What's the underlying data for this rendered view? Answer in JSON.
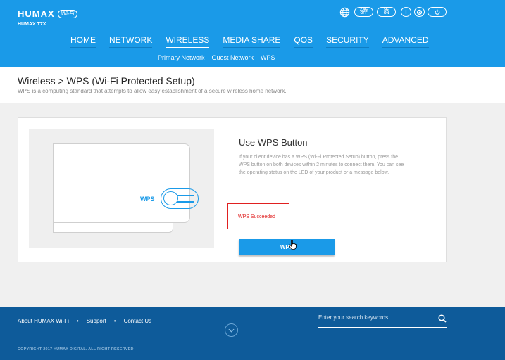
{
  "brand": {
    "name": "HUMAX",
    "badge": "Wi-Fi",
    "model": "HUMAX T7X"
  },
  "top_icons": [
    {
      "name": "globe-icon"
    },
    {
      "name": "band-2g-icon",
      "label": "2.4G\nOFF"
    },
    {
      "name": "band-5g-icon",
      "label": "5G\nON"
    },
    {
      "name": "info-icon",
      "label": "i"
    },
    {
      "name": "settings-icon"
    },
    {
      "name": "power-icon"
    }
  ],
  "nav": {
    "items": [
      "HOME",
      "NETWORK",
      "WIRELESS",
      "MEDIA SHARE",
      "QOS",
      "SECURITY",
      "ADVANCED"
    ],
    "active": "WIRELESS"
  },
  "subnav": {
    "items": [
      "Primary Network",
      "Guest Network",
      "WPS"
    ],
    "active": "WPS"
  },
  "page": {
    "title": "Wireless > WPS (Wi-Fi Protected Setup)",
    "description": "WPS is a computing standard that attempts to allow easy establishment of a secure wireless home network."
  },
  "card": {
    "illustration_label": "WPS",
    "heading": "Use WPS Button",
    "text": "If your client device has a WPS (Wi-Fi Protected Setup) button, press the WPS button on both devices within 2 minutes to connect them. You can see the operating status on the LED of your product or a message below.",
    "status": "WPS Succeeded",
    "button_label": "WPS"
  },
  "footer": {
    "links": [
      "About HUMAX Wi-Fi",
      "Support",
      "Contact Us"
    ],
    "search_placeholder": "Enter your search keywords.",
    "copyright": "COPYRIGHT 2017 HUMAX DIGITAL. ALL RIGHT RESERVED"
  },
  "colors": {
    "primary": "#1a9ae8",
    "footer": "#0e5b9a",
    "error": "#e02020"
  }
}
